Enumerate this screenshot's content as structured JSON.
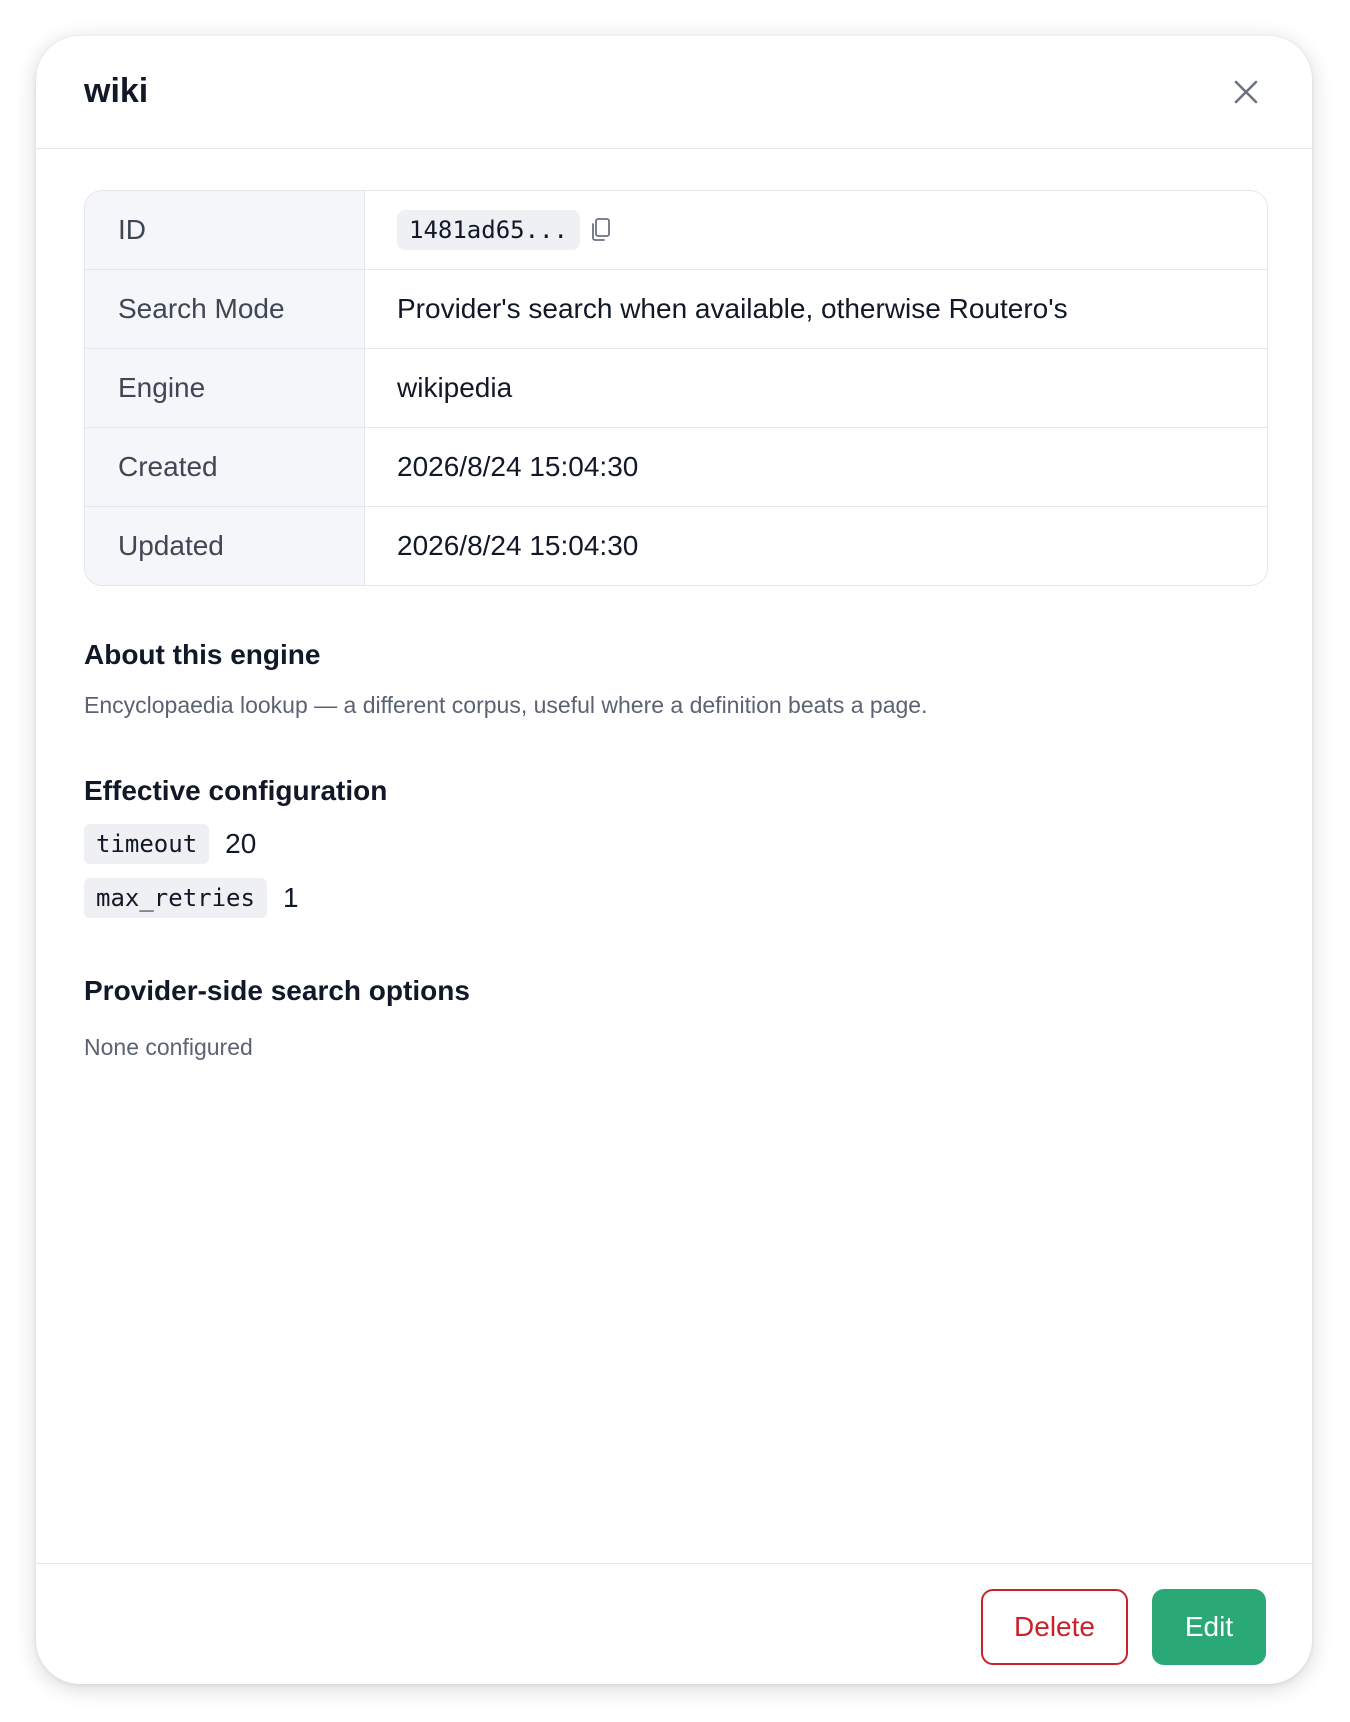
{
  "modal": {
    "title": "wiki"
  },
  "details": {
    "id": {
      "label": "ID",
      "value": "1481ad65..."
    },
    "search_mode": {
      "label": "Search Mode",
      "value": "Provider's search when available, otherwise Routero's"
    },
    "engine": {
      "label": "Engine",
      "value": "wikipedia"
    },
    "created": {
      "label": "Created",
      "value": "2026/8/24 15:04:30"
    },
    "updated": {
      "label": "Updated",
      "value": "2026/8/24 15:04:30"
    }
  },
  "about": {
    "title": "About this engine",
    "text": "Encyclopaedia lookup — a different corpus, useful where a definition beats a page."
  },
  "config": {
    "title": "Effective configuration",
    "items": [
      {
        "key": "timeout",
        "value": "20"
      },
      {
        "key": "max_retries",
        "value": "1"
      }
    ]
  },
  "provider_options": {
    "title": "Provider-side search options",
    "text": "None configured"
  },
  "footer": {
    "delete_label": "Delete",
    "edit_label": "Edit"
  },
  "colors": {
    "danger": "#c8232a",
    "primary": "#2aa876"
  },
  "icons": {
    "close": "close-icon",
    "copy": "copy-icon"
  }
}
